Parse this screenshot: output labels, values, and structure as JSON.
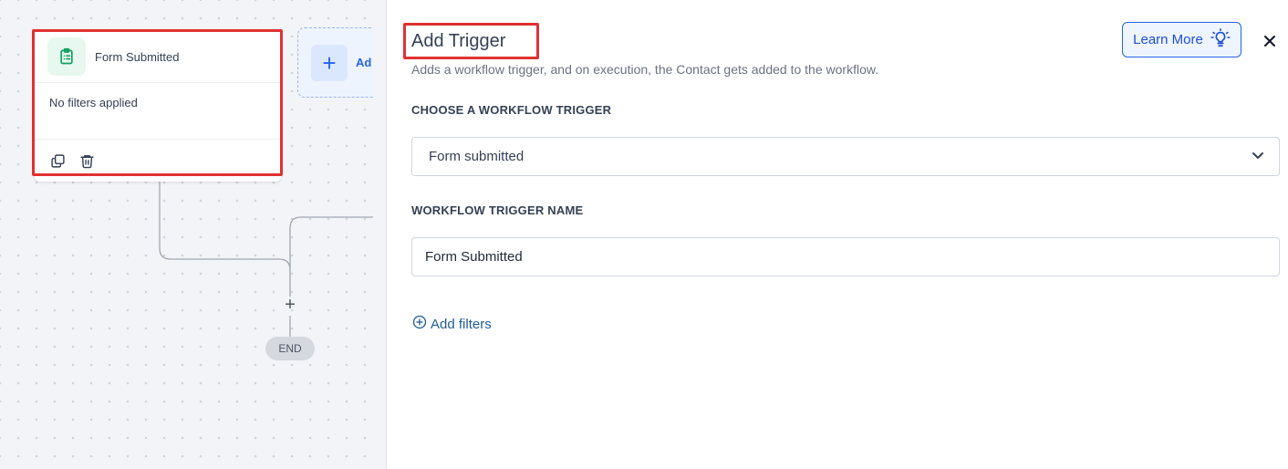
{
  "canvas": {
    "trigger_card": {
      "title": "Form Submitted",
      "filters_text": "No filters applied"
    },
    "add_trigger_tile": {
      "label": "Ad"
    },
    "add_step_symbol": "+",
    "end_label": "END"
  },
  "panel": {
    "title": "Add Trigger",
    "subtitle": "Adds a workflow trigger, and on execution, the Contact gets added to the workflow.",
    "learn_more_label": "Learn More",
    "choose_trigger": {
      "label": "CHOOSE A WORKFLOW TRIGGER",
      "selected": "Form submitted"
    },
    "trigger_name": {
      "label": "WORKFLOW TRIGGER NAME",
      "value": "Form Submitted"
    },
    "add_filters_label": "Add filters"
  },
  "colors": {
    "accent": "#2563eb",
    "highlight": "#e03131",
    "trigger_icon": "#12a15e"
  },
  "icons": {
    "trigger": "clipboard-list-icon",
    "copy": "copy-icon",
    "delete": "trash-icon",
    "learn_more": "lightbulb-icon",
    "close": "close-icon",
    "dropdown": "chevron-down-icon",
    "add_filters": "plus-circle-icon"
  }
}
